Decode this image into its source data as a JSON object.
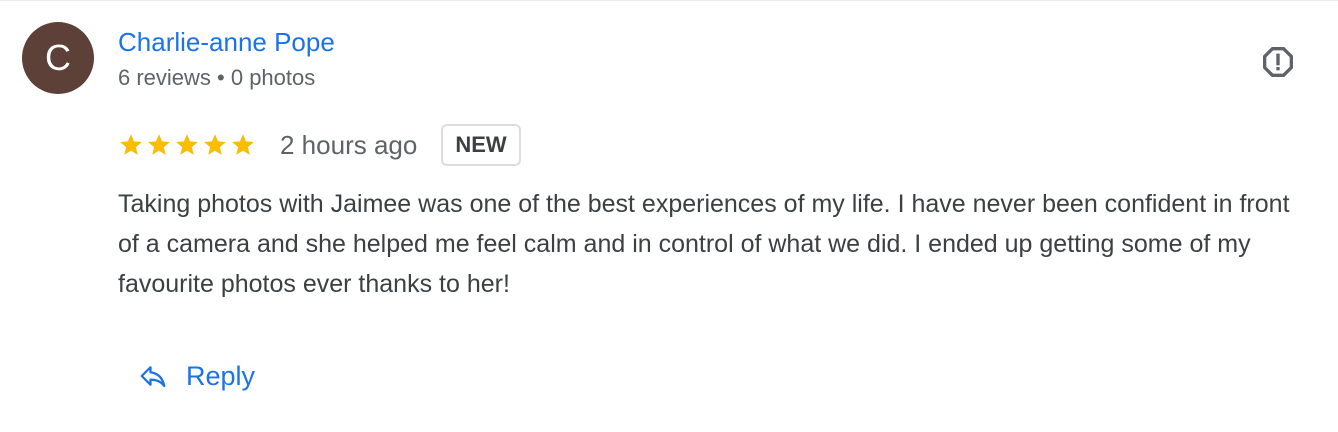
{
  "review": {
    "avatar_initial": "C",
    "avatar_color": "#5d4037",
    "author_name": "Charlie-anne Pope",
    "author_meta": "6 reviews • 0 photos",
    "rating": 5,
    "time_ago": "2 hours ago",
    "badge": "NEW",
    "text": "Taking photos with Jaimee was one of the best experiences of my life. I have never been confident in front of a camera and she helped me feel calm and in control of what we did. I ended up getting some of my favourite photos ever thanks to her!",
    "report_icon": "report-icon"
  },
  "actions": {
    "reply_label": "Reply",
    "reply_icon": "reply-arrow-icon"
  },
  "colors": {
    "link": "#1a73e8",
    "star": "#fbbc04",
    "text": "#3c4043",
    "secondary": "#5f6368"
  }
}
